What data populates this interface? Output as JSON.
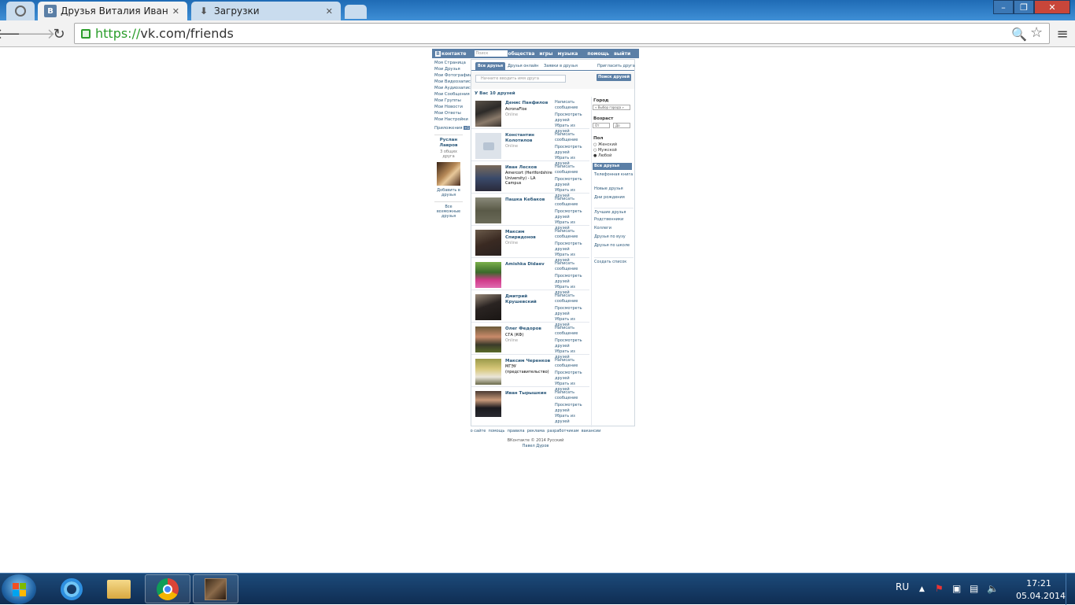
{
  "browser": {
    "tabs": [
      {
        "title": "Друзья Виталия Иванова",
        "active": true,
        "favicon": "vk-icon"
      },
      {
        "title": "Загрузки",
        "active": false,
        "favicon": "download-icon"
      }
    ],
    "url_scheme": "https://",
    "url_rest": "vk.com/friends",
    "window_controls": {
      "minimize": "–",
      "maximize": "❐",
      "close": "✕"
    }
  },
  "vk": {
    "logo_text": "контакте",
    "logo_letter": "В",
    "search_placeholder": "Поиск",
    "nav": [
      "общества",
      "игры",
      "музыка",
      "помощь",
      "выйти"
    ],
    "left_menu": [
      "Моя Страница",
      "Мои Друзья",
      "Мои Фотографии",
      "Мои Видеозаписи",
      "Мои Аудиозаписи",
      "Мои Сообщения",
      "Мои Группы",
      "Мои Новости",
      "Мои Ответы",
      "Мои Настройки",
      "Приложения"
    ],
    "left_menu_badge": "+1",
    "common_friend": {
      "name": "Руслан Лавров",
      "count": "3 общих друга",
      "add": "Добавить в друзья",
      "all": "Все возможные друзья"
    },
    "tabs": [
      {
        "label": "Все друзья",
        "selected": true
      },
      {
        "label": "Друзья онлайн",
        "selected": false
      },
      {
        "label": "Заявки в друзья",
        "selected": false
      },
      {
        "label": "Пригласить друга",
        "selected": false
      }
    ],
    "filter_placeholder": "Начните вводить имя друга",
    "search_button": "Поиск друзей",
    "count_text": "У Вас 10 друзей",
    "friend_actions": [
      "Написать сообщение",
      "Просмотреть друзей",
      "Убрать из друзей"
    ],
    "friends": [
      {
        "name": "Денис Панфилов",
        "sub": "AcronaFlox",
        "online": "Online"
      },
      {
        "name": "Константин Колотилов",
        "sub": "",
        "online": "Online"
      },
      {
        "name": "Иван Лесков",
        "sub": "Amercort (Hertfordshire University) - LA Campus",
        "online": ""
      },
      {
        "name": "Пашка Кебаков",
        "sub": "",
        "online": ""
      },
      {
        "name": "Максим Спиридонов",
        "sub": "",
        "online": "Online"
      },
      {
        "name": "Amishka Didaev",
        "sub": "",
        "online": ""
      },
      {
        "name": "Дмитрий Крушевский",
        "sub": "",
        "online": ""
      },
      {
        "name": "Олег Федоров",
        "sub": "СГА (КФ)",
        "online": "Online"
      },
      {
        "name": "Максим Черенков",
        "sub": "МГЭУ (представительство)",
        "online": ""
      },
      {
        "name": "Иван Тырышкин",
        "sub": "",
        "online": ""
      }
    ],
    "right": {
      "city_label": "Город",
      "city_value": "« Выбор города »",
      "age_label": "Возраст",
      "age_from": "От",
      "age_to": "До",
      "sex_label": "Пол",
      "sex_options": [
        "Женский",
        "Мужской",
        "Любой"
      ],
      "sex_selected": "Любой",
      "lists_selected": "Все друзья",
      "lists": [
        "Телефонная книга",
        "Новые друзья",
        "Дни рождения",
        "Лучшие друзья",
        "Родственники",
        "Коллеги",
        "Друзья по вузу",
        "Друзья по школе",
        "Создать список"
      ]
    },
    "footer_links": [
      "о сайте",
      "помощь",
      "правила",
      "реклама",
      "разработчикам",
      "вакансии"
    ],
    "copyright": "ВКонтакте © 2014 Русский",
    "author": "Павел Дуров"
  },
  "taskbar": {
    "lang": "RU",
    "time": "17:21",
    "date": "05.04.2014"
  }
}
